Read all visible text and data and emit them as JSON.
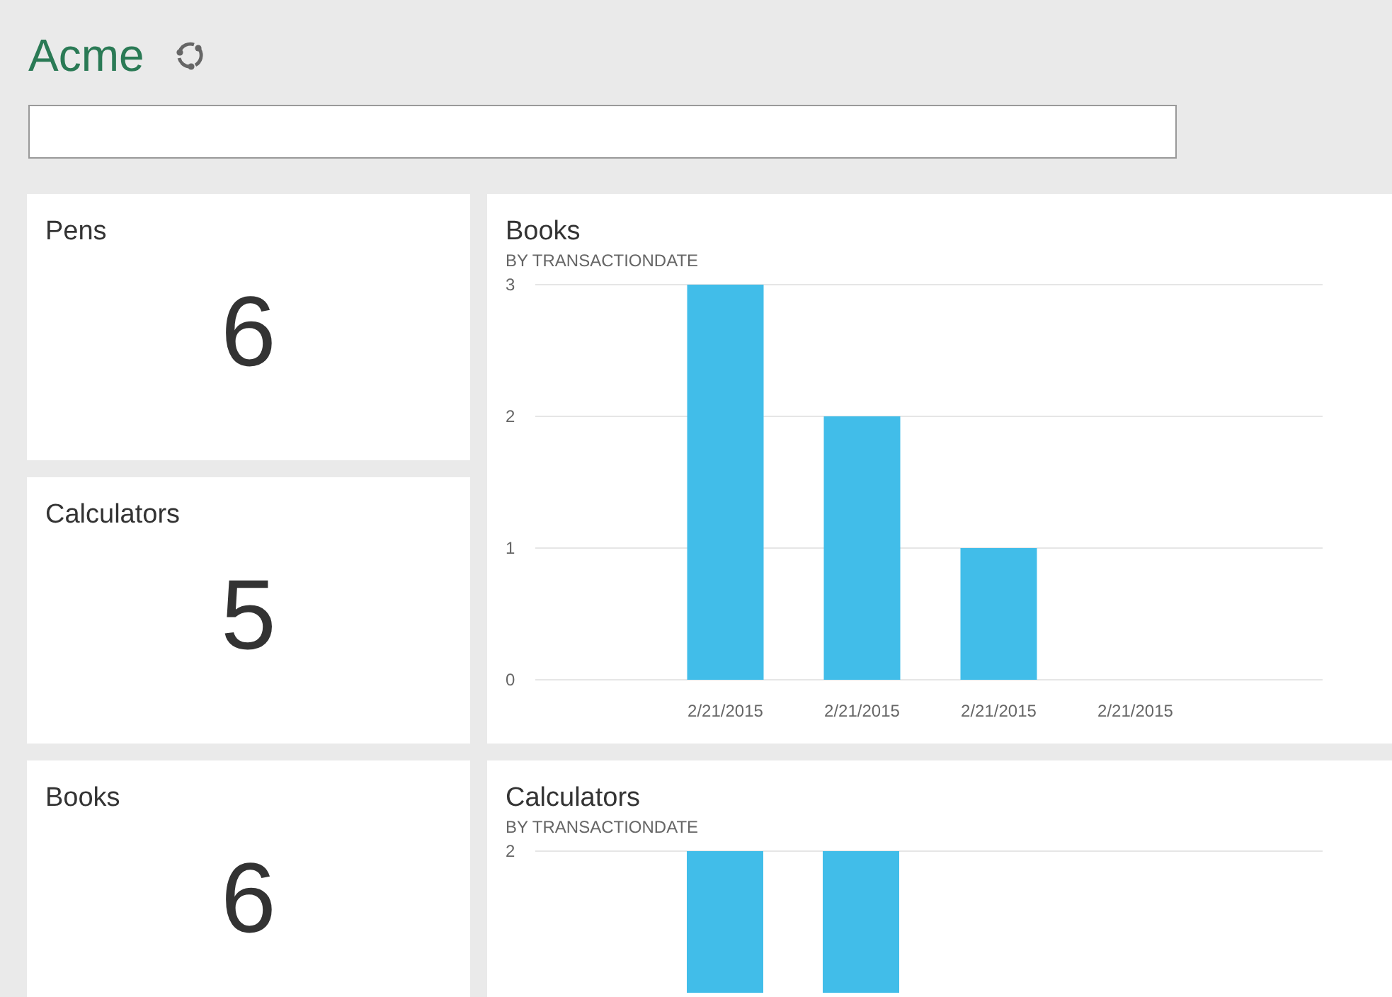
{
  "header": {
    "title": "Acme"
  },
  "tiles": [
    {
      "kind": "kpi",
      "title": "Pens",
      "value": "6"
    },
    {
      "kind": "chart",
      "title": "Books",
      "subtitle": "BY TRANSACTIONDATE",
      "chart_data": {
        "type": "bar",
        "categories": [
          "2/21/2015",
          "2/21/2015",
          "2/21/2015",
          "2/21/2015"
        ],
        "values": [
          3,
          2,
          1,
          0
        ],
        "ylim": [
          0,
          3
        ],
        "yticks": [
          0,
          1,
          2,
          3
        ]
      }
    },
    {
      "kind": "kpi",
      "title": "Calculators",
      "value": "5"
    },
    {
      "kind": "kpi",
      "title": "Books",
      "value": "6"
    },
    {
      "kind": "chart_picture",
      "title": "Calculators",
      "subtitle": "BY TRANSACTIONDATE",
      "axis_label": "2"
    }
  ]
}
